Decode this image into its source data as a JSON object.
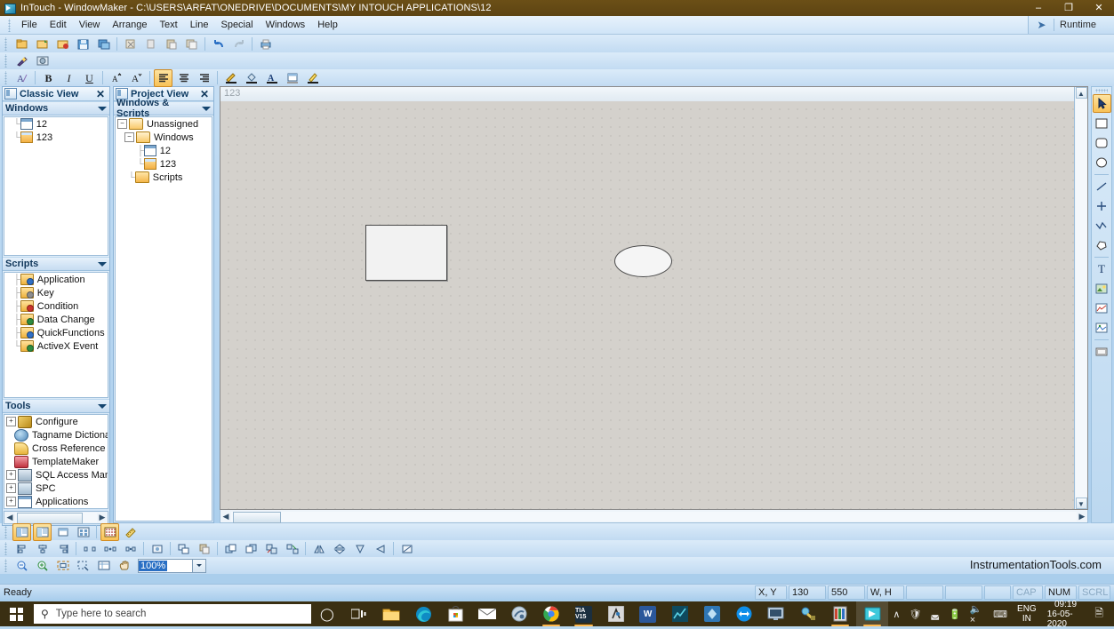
{
  "window": {
    "title": "InTouch - WindowMaker - C:\\USERS\\ARFAT\\ONEDRIVE\\DOCUMENTS\\MY INTOUCH APPLICATIONS\\12",
    "minimize": "–",
    "maximize": "❐",
    "close": "✕",
    "app_icon": "intouch-logo-icon"
  },
  "menubar": {
    "items": [
      "File",
      "Edit",
      "View",
      "Arrange",
      "Text",
      "Line",
      "Special",
      "Windows",
      "Help"
    ],
    "runtime_label": "Runtime",
    "runtime_icon": "runtime-arrow-icon"
  },
  "toolbars": {
    "standard": [
      {
        "name": "new-window-button",
        "icon": "new-window-icon"
      },
      {
        "name": "open-window-button",
        "icon": "open-window-icon"
      },
      {
        "name": "close-window-button",
        "icon": "close-window-icon"
      },
      {
        "name": "save-button",
        "icon": "save-disk-icon"
      },
      {
        "name": "save-all-button",
        "icon": "save-all-icon"
      },
      {
        "name": "cut-button",
        "icon": "cut-icon"
      },
      {
        "name": "copy-button",
        "icon": "copy-icon"
      },
      {
        "name": "paste-button",
        "icon": "paste-icon"
      },
      {
        "name": "duplicate-button",
        "icon": "duplicate-icon"
      },
      {
        "name": "undo-button",
        "icon": "undo-arrow-icon"
      },
      {
        "name": "redo-button",
        "icon": "redo-arrow-icon"
      },
      {
        "name": "print-button",
        "icon": "printer-icon"
      }
    ],
    "wizards": [
      {
        "name": "wizard-button",
        "icon": "magic-wand-icon"
      },
      {
        "name": "symbol-factory-button",
        "icon": "symbol-factory-icon"
      }
    ],
    "format": [
      {
        "name": "font-button",
        "icon": "font-icon",
        "label": "A"
      },
      {
        "name": "bold-button",
        "icon": "bold-icon",
        "label": "B",
        "active": false
      },
      {
        "name": "italic-button",
        "icon": "italic-icon",
        "label": "I"
      },
      {
        "name": "underline-button",
        "icon": "underline-icon",
        "label": "U"
      },
      {
        "name": "decrease-font-button",
        "icon": "shrink-font-icon",
        "label": "A"
      },
      {
        "name": "increase-font-button",
        "icon": "grow-font-icon",
        "label": "A"
      },
      {
        "name": "align-left-button",
        "icon": "align-left-icon",
        "active": true
      },
      {
        "name": "align-center-button",
        "icon": "align-center-icon"
      },
      {
        "name": "align-right-button",
        "icon": "align-right-icon"
      },
      {
        "name": "line-color-button",
        "icon": "line-color-pencil-icon"
      },
      {
        "name": "fill-color-button",
        "icon": "fill-color-bucket-icon"
      },
      {
        "name": "text-color-button",
        "icon": "text-color-icon"
      },
      {
        "name": "window-color-button",
        "icon": "window-color-icon"
      },
      {
        "name": "highlight-color-button",
        "icon": "highlight-color-icon"
      }
    ],
    "view_row": [
      {
        "name": "classic-view-toggle",
        "icon": "classic-view-icon",
        "active": true
      },
      {
        "name": "project-view-toggle",
        "icon": "project-view-icon",
        "active": true
      },
      {
        "name": "window-list-toggle",
        "icon": "window-list-icon"
      },
      {
        "name": "thumbnail-toggle",
        "icon": "thumbnail-icon"
      },
      {
        "name": "show-grid-toggle",
        "icon": "grid-dots-icon",
        "active": true
      },
      {
        "name": "ruler-toggle",
        "icon": "ruler-icon"
      }
    ],
    "arrange_row": [
      {
        "name": "align-objects-left-button",
        "icon": "align-objects-left-icon"
      },
      {
        "name": "align-objects-center-button",
        "icon": "align-objects-center-icon"
      },
      {
        "name": "align-objects-right-button",
        "icon": "align-objects-right-icon"
      },
      {
        "name": "space-evenly-button",
        "icon": "space-evenly-icon"
      },
      {
        "name": "center-horizontally-button",
        "icon": "center-horizontal-icon"
      },
      {
        "name": "center-vertically-button",
        "icon": "center-vertical-icon"
      },
      {
        "name": "snap-button",
        "icon": "snap-icon"
      },
      {
        "name": "duplicate-object-button",
        "icon": "duplicate-object-icon"
      },
      {
        "name": "paste-object-button",
        "icon": "paste-object-icon"
      },
      {
        "name": "bring-to-front-button",
        "icon": "bring-to-front-icon"
      },
      {
        "name": "send-to-back-button",
        "icon": "send-to-back-icon"
      },
      {
        "name": "group-button",
        "icon": "group-icon"
      },
      {
        "name": "ungroup-button",
        "icon": "ungroup-icon"
      },
      {
        "name": "flip-horizontal-button",
        "icon": "flip-horizontal-icon"
      },
      {
        "name": "flip-vertical-button",
        "icon": "flip-vertical-icon"
      },
      {
        "name": "rotate-button",
        "icon": "rotate-icon"
      },
      {
        "name": "reshape-button",
        "icon": "reshape-icon"
      },
      {
        "name": "edit-points-button",
        "icon": "edit-points-icon"
      }
    ],
    "zoom_row": [
      {
        "name": "zoom-out-button",
        "icon": "zoom-out-icon"
      },
      {
        "name": "zoom-in-button",
        "icon": "zoom-in-icon"
      },
      {
        "name": "zoom-fit-button",
        "icon": "zoom-fit-icon"
      },
      {
        "name": "zoom-selection-button",
        "icon": "zoom-selection-icon"
      },
      {
        "name": "zoom-window-button",
        "icon": "zoom-window-icon"
      },
      {
        "name": "pan-button",
        "icon": "hand-pan-icon"
      }
    ],
    "zoom_value": "100%"
  },
  "drawing_toolbar": [
    {
      "name": "select-tool",
      "icon": "arrow-pointer-icon",
      "active": true
    },
    {
      "name": "rectangle-tool",
      "icon": "rectangle-icon"
    },
    {
      "name": "rounded-rectangle-tool",
      "icon": "rounded-rectangle-icon"
    },
    {
      "name": "ellipse-tool",
      "icon": "ellipse-icon"
    },
    {
      "name": "line-tool",
      "icon": "line-icon"
    },
    {
      "name": "h-v-line-tool",
      "icon": "plus-line-icon"
    },
    {
      "name": "polyline-tool",
      "icon": "polyline-icon"
    },
    {
      "name": "polygon-tool",
      "icon": "polygon-icon"
    },
    {
      "name": "text-tool",
      "icon": "text-t-icon"
    },
    {
      "name": "bitmap-tool",
      "icon": "bitmap-image-icon"
    },
    {
      "name": "realtime-trend-tool",
      "icon": "realtime-trend-icon"
    },
    {
      "name": "historical-trend-tool",
      "icon": "historical-trend-icon"
    },
    {
      "name": "button-tool",
      "icon": "button-control-icon"
    }
  ],
  "classic_view": {
    "title": "Classic View",
    "close_icon": "✕",
    "sections": [
      {
        "title": "Windows",
        "items": [
          {
            "label": "12",
            "icon": "window-blank-icon"
          },
          {
            "label": "123",
            "icon": "window-filled-icon"
          }
        ]
      },
      {
        "title": "Scripts",
        "items": [
          {
            "label": "Application",
            "icon": "script-application-icon"
          },
          {
            "label": "Key",
            "icon": "script-key-icon"
          },
          {
            "label": "Condition",
            "icon": "script-condition-icon"
          },
          {
            "label": "Data Change",
            "icon": "script-data-change-icon"
          },
          {
            "label": "QuickFunctions",
            "icon": "script-quickfunctions-icon"
          },
          {
            "label": "ActiveX Event",
            "icon": "script-activex-icon"
          }
        ]
      },
      {
        "title": "Tools",
        "items": [
          {
            "label": "Configure",
            "icon": "wrench-icon",
            "expandable": true
          },
          {
            "label": "Tagname Dictiona",
            "icon": "tagname-dictionary-icon",
            "expandable": false
          },
          {
            "label": "Cross Reference",
            "icon": "cross-reference-icon",
            "expandable": false
          },
          {
            "label": "TemplateMaker",
            "icon": "template-maker-icon",
            "expandable": false
          },
          {
            "label": "SQL Access Mana",
            "icon": "sql-access-icon",
            "expandable": true
          },
          {
            "label": "SPC",
            "icon": "spc-icon",
            "expandable": true
          },
          {
            "label": "Applications",
            "icon": "applications-icon",
            "expandable": true
          }
        ]
      }
    ]
  },
  "project_view": {
    "title": "Project View",
    "close_icon": "✕",
    "section_title": "Windows & Scripts",
    "tree": [
      {
        "label": "Unassigned",
        "icon": "folder-open-icon",
        "level": 0,
        "expander": "−"
      },
      {
        "label": "Windows",
        "icon": "folder-open-icon",
        "level": 1,
        "expander": "−"
      },
      {
        "label": "12",
        "icon": "window-blank-icon",
        "level": 2,
        "expander": ""
      },
      {
        "label": "123",
        "icon": "window-filled-icon",
        "level": 2,
        "expander": ""
      },
      {
        "label": "Scripts",
        "icon": "scripts-folder-icon",
        "level": 1,
        "expander": ""
      }
    ]
  },
  "canvas": {
    "window_name": "123",
    "objects": [
      {
        "name": "rectangle-object",
        "type": "rectangle"
      },
      {
        "name": "ellipse-object",
        "type": "ellipse"
      }
    ]
  },
  "watermark": "InstrumentationTools.com",
  "statusbar": {
    "ready": "Ready",
    "xy_label": "X, Y",
    "x": "130",
    "y": "550",
    "wh_label": "W, H",
    "w": "",
    "h": "",
    "caps": "CAP",
    "num": "NUM",
    "scroll": "SCRL"
  },
  "taskbar": {
    "start_icon": "windows-logo-icon",
    "search_placeholder": "Type here to search",
    "search_icon": "search-icon",
    "cortana_icon": "cortana-circle-icon",
    "taskview_icon": "task-view-icon",
    "apps": [
      {
        "name": "file-explorer",
        "icon": "folder-icon",
        "color": "#f7c14b",
        "label": ""
      },
      {
        "name": "microsoft-edge",
        "icon": "edge-icon",
        "color": "#1e88c7",
        "label": ""
      },
      {
        "name": "microsoft-store",
        "icon": "store-icon",
        "color": "#ffffff",
        "label": ""
      },
      {
        "name": "mail",
        "icon": "mail-envelope-icon",
        "color": "#ffffff",
        "label": ""
      },
      {
        "name": "paint-3d",
        "icon": "paint-icon",
        "color": "#b9c7d6",
        "label": ""
      },
      {
        "name": "google-chrome",
        "icon": "chrome-icon",
        "color": "#ffffff",
        "label": ""
      },
      {
        "name": "tia-portal-v15",
        "icon": "tia-v15-icon",
        "color": "#ffffff",
        "label": "TIA V15"
      },
      {
        "name": "simatic-tool",
        "icon": "simatic-icon",
        "color": "#d9d9d9",
        "label": ""
      },
      {
        "name": "microsoft-word",
        "icon": "word-icon",
        "color": "#2b579a",
        "label": "W"
      },
      {
        "name": "wincc-runtime",
        "icon": "wincc-icon",
        "color": "#0e4a5e",
        "label": ""
      },
      {
        "name": "archestra-ide",
        "icon": "archestra-icon",
        "color": "#2f77b5",
        "label": ""
      },
      {
        "name": "teamviewer",
        "icon": "teamviewer-icon",
        "color": "#0e8ee9",
        "label": ""
      },
      {
        "name": "remote-desktop",
        "icon": "remote-desktop-icon",
        "color": "#9fb8cc",
        "label": ""
      },
      {
        "name": "drive-tool",
        "icon": "drive-tool-icon",
        "color": "#e0c45a",
        "label": ""
      },
      {
        "name": "plc-sim",
        "icon": "plc-sim-icon",
        "color": "#b44a4a",
        "label": ""
      },
      {
        "name": "intouch-windowmaker",
        "icon": "intouch-logo-icon",
        "color": "#3ec9dc",
        "label": "",
        "active": true
      }
    ],
    "tray": {
      "chevron": "∧",
      "icons": [
        "security-shield-icon",
        "wifi-icon",
        "battery-icon",
        "speaker-muted-icon",
        "keyboard-icon"
      ],
      "language_top": "ENG",
      "language_bottom": "IN",
      "time": "09:19",
      "date": "16-05-2020",
      "notification_icon": "action-center-icon"
    }
  }
}
